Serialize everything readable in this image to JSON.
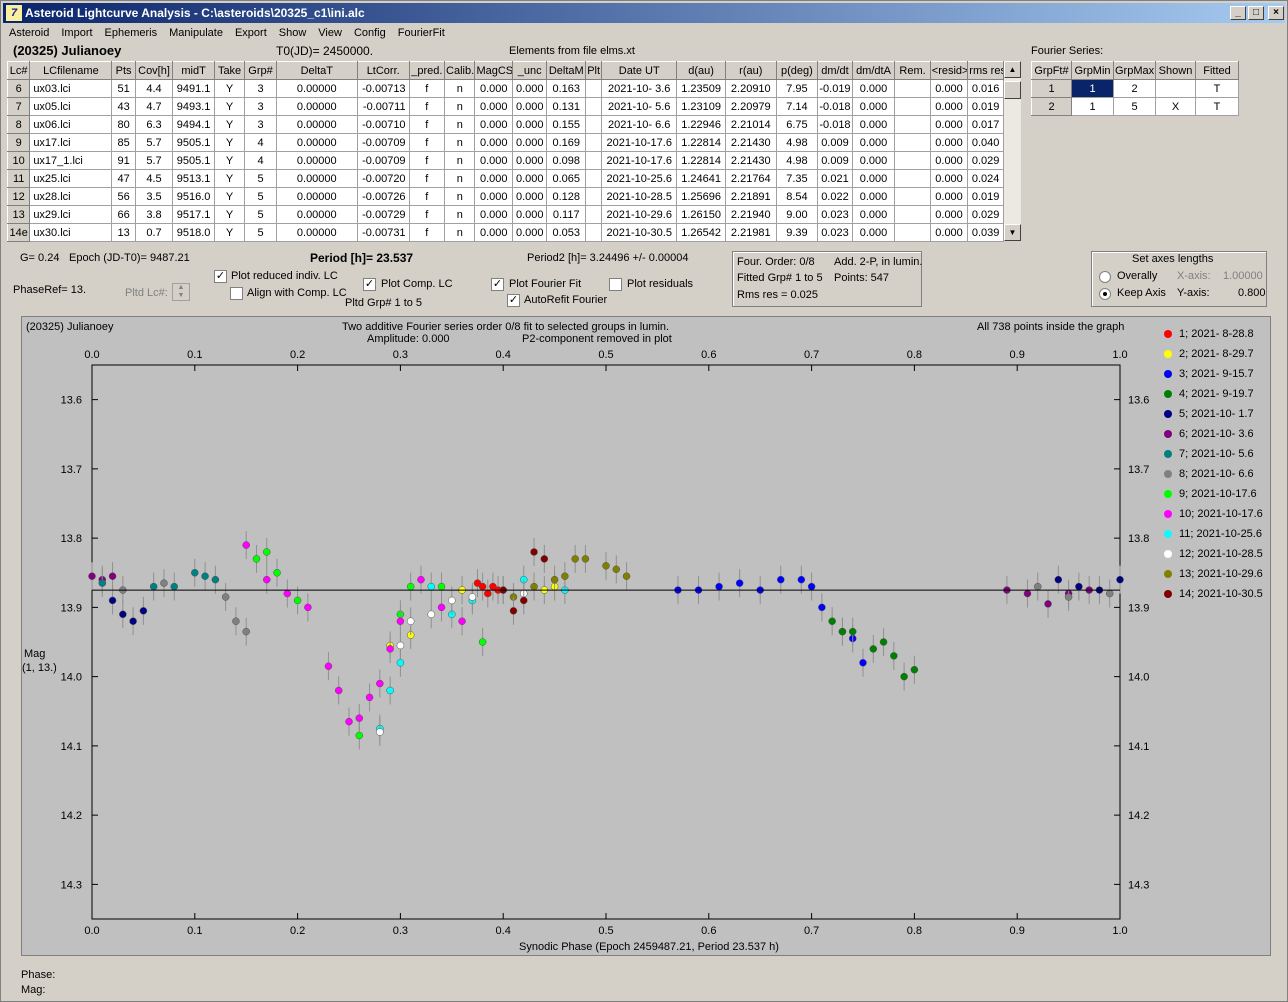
{
  "window": {
    "title": "Asteroid Lightcurve Analysis - C:\\asteroids\\20325_c1\\ini.alc",
    "icon": "app-logo-icon"
  },
  "menu": [
    "Asteroid",
    "Import",
    "Ephemeris",
    "Manipulate",
    "Export",
    "Show",
    "View",
    "Config",
    "FourierFit"
  ],
  "header": {
    "asteroid": "(20325) Julianoey",
    "t0": "T0(JD)= 2450000.",
    "elements": "Elements from file elms.xt",
    "fourier_series": "Fourier Series:"
  },
  "lc_table": {
    "columns": [
      "Lc#",
      "LCfilename",
      "Pts",
      "Cov[h]",
      "midT",
      "Take",
      "Grp#",
      "DeltaT",
      "LtCorr.",
      "_pred.",
      "Calib.",
      "MagCS",
      "_unc",
      "DeltaM",
      "Plt",
      "Date UT",
      "d(au)",
      "r(au)",
      "p(deg)",
      "dm/dt",
      "dm/dtA",
      "Rem.",
      "<resid>",
      "rms res"
    ],
    "rows": [
      [
        "6",
        "ux03.lci",
        "51",
        "4.4",
        "9491.1",
        "Y",
        "3",
        "0.00000",
        "-0.00713",
        "f",
        "n",
        "0.000",
        "0.000",
        "0.163",
        "",
        "2021-10- 3.6",
        "1.23509",
        "2.20910",
        "7.95",
        "-0.019",
        "0.000",
        "",
        "0.000",
        "0.016"
      ],
      [
        "7",
        "ux05.lci",
        "43",
        "4.7",
        "9493.1",
        "Y",
        "3",
        "0.00000",
        "-0.00711",
        "f",
        "n",
        "0.000",
        "0.000",
        "0.131",
        "",
        "2021-10- 5.6",
        "1.23109",
        "2.20979",
        "7.14",
        "-0.018",
        "0.000",
        "",
        "0.000",
        "0.019"
      ],
      [
        "8",
        "ux06.lci",
        "80",
        "6.3",
        "9494.1",
        "Y",
        "3",
        "0.00000",
        "-0.00710",
        "f",
        "n",
        "0.000",
        "0.000",
        "0.155",
        "",
        "2021-10- 6.6",
        "1.22946",
        "2.21014",
        "6.75",
        "-0.018",
        "0.000",
        "",
        "0.000",
        "0.017"
      ],
      [
        "9",
        "ux17.lci",
        "85",
        "5.7",
        "9505.1",
        "Y",
        "4",
        "0.00000",
        "-0.00709",
        "f",
        "n",
        "0.000",
        "0.000",
        "0.169",
        "",
        "2021-10-17.6",
        "1.22814",
        "2.21430",
        "4.98",
        "0.009",
        "0.000",
        "",
        "0.000",
        "0.040"
      ],
      [
        "10",
        "ux17_1.lci",
        "91",
        "5.7",
        "9505.1",
        "Y",
        "4",
        "0.00000",
        "-0.00709",
        "f",
        "n",
        "0.000",
        "0.000",
        "0.098",
        "",
        "2021-10-17.6",
        "1.22814",
        "2.21430",
        "4.98",
        "0.009",
        "0.000",
        "",
        "0.000",
        "0.029"
      ],
      [
        "11",
        "ux25.lci",
        "47",
        "4.5",
        "9513.1",
        "Y",
        "5",
        "0.00000",
        "-0.00720",
        "f",
        "n",
        "0.000",
        "0.000",
        "0.065",
        "",
        "2021-10-25.6",
        "1.24641",
        "2.21764",
        "7.35",
        "0.021",
        "0.000",
        "",
        "0.000",
        "0.024"
      ],
      [
        "12",
        "ux28.lci",
        "56",
        "3.5",
        "9516.0",
        "Y",
        "5",
        "0.00000",
        "-0.00726",
        "f",
        "n",
        "0.000",
        "0.000",
        "0.128",
        "",
        "2021-10-28.5",
        "1.25696",
        "2.21891",
        "8.54",
        "0.022",
        "0.000",
        "",
        "0.000",
        "0.019"
      ],
      [
        "13",
        "ux29.lci",
        "66",
        "3.8",
        "9517.1",
        "Y",
        "5",
        "0.00000",
        "-0.00729",
        "f",
        "n",
        "0.000",
        "0.000",
        "0.117",
        "",
        "2021-10-29.6",
        "1.26150",
        "2.21940",
        "9.00",
        "0.023",
        "0.000",
        "",
        "0.000",
        "0.029"
      ],
      [
        "14e",
        "ux30.lci",
        "13",
        "0.7",
        "9518.0",
        "Y",
        "5",
        "0.00000",
        "-0.00731",
        "f",
        "n",
        "0.000",
        "0.000",
        "0.053",
        "",
        "2021-10-30.5",
        "1.26542",
        "2.21981",
        "9.39",
        "0.023",
        "0.000",
        "",
        "0.000",
        "0.039"
      ]
    ]
  },
  "fourier_table": {
    "columns": [
      "GrpFt#",
      "GrpMin",
      "GrpMax",
      "Shown",
      "Fitted"
    ],
    "rows": [
      [
        "1",
        "1",
        "2",
        "",
        "T"
      ],
      [
        "2",
        "1",
        "5",
        "X",
        "T"
      ]
    ]
  },
  "controls": {
    "g": "G= 0.24",
    "epoch": "Epoch (JD-T0)= 9487.21",
    "period": "Period [h]= 23.537",
    "period2": "Period2 [h]= 3.24496 +/- 0.00004",
    "phaseref": "PhaseRef= 13.",
    "pltd_lc": "Pltd Lc#:",
    "plot_reduced": "Plot reduced indiv. LC",
    "align_comp": "Align with Comp. LC",
    "plot_comp": "Plot Comp. LC",
    "pltd_grp": "Pltd Grp#  1   to   5",
    "plot_fourier": "Plot Fourier Fit",
    "autorefit": "AutoRefit Fourier",
    "plot_residuals": "Plot residuals",
    "four_order": "Four. Order:  0/8",
    "add2p": "Add. 2-P, in lumin.",
    "fitted_grp": "Fitted Grp# 1 to 5",
    "points": "Points: 547",
    "rms": "Rms res     = 0.025",
    "axes_title": "Set axes lengths",
    "overally": "Overally",
    "keep_axis": "Keep Axis",
    "xaxis_lbl": "X-axis:",
    "xaxis_val": "1.00000",
    "yaxis_lbl": "Y-axis:",
    "yaxis_val": "0.800"
  },
  "plot": {
    "name": "(20325) Julianoey",
    "title1": "Two additive Fourier series order 0/8 fit to selected groups in lumin.",
    "title2": "Amplitude: 0.000",
    "p2note": "P2-component removed in plot",
    "allpts": "All 738 points inside the graph",
    "ylabel1": "Mag",
    "ylabel2": "(1, 13.)",
    "xlabel": "Synodic Phase (Epoch 2459487.21, Period 23.537 h)"
  },
  "chart_data": {
    "type": "scatter",
    "xlabel": "Synodic Phase (Epoch 2459487.21, Period 23.537 h)",
    "ylabel": "Mag",
    "xlim": [
      0.0,
      1.0
    ],
    "ylim": [
      14.35,
      13.55
    ],
    "yreversed": true,
    "xticks": [
      "0.0",
      "0.1",
      "0.2",
      "0.3",
      "0.4",
      "0.5",
      "0.6",
      "0.7",
      "0.8",
      "0.9",
      "1.0"
    ],
    "yticks": [
      "13.6",
      "13.7",
      "13.8",
      "13.9",
      "14.0",
      "14.1",
      "14.2",
      "14.3"
    ],
    "fit_line_mag": 13.875,
    "series": [
      {
        "name": "1; 2021- 8-28.8",
        "color": "#ff0000",
        "points": [
          [
            0.375,
            13.865
          ],
          [
            0.38,
            13.87
          ],
          [
            0.385,
            13.88
          ],
          [
            0.39,
            13.87
          ],
          [
            0.395,
            13.875
          ]
        ]
      },
      {
        "name": "2; 2021- 8-29.7",
        "color": "#ffff00",
        "points": [
          [
            0.29,
            13.955
          ],
          [
            0.31,
            13.94
          ],
          [
            0.36,
            13.875
          ],
          [
            0.44,
            13.875
          ],
          [
            0.45,
            13.87
          ]
        ]
      },
      {
        "name": "3; 2021- 9-15.7",
        "color": "#0000ff",
        "points": [
          [
            0.57,
            13.875
          ],
          [
            0.59,
            13.875
          ],
          [
            0.61,
            13.87
          ],
          [
            0.63,
            13.865
          ],
          [
            0.65,
            13.875
          ],
          [
            0.67,
            13.86
          ],
          [
            0.69,
            13.86
          ],
          [
            0.7,
            13.87
          ],
          [
            0.71,
            13.9
          ],
          [
            0.73,
            13.935
          ],
          [
            0.74,
            13.945
          ],
          [
            0.75,
            13.98
          ]
        ]
      },
      {
        "name": "4; 2021- 9-19.7",
        "color": "#008000",
        "points": [
          [
            0.72,
            13.92
          ],
          [
            0.73,
            13.935
          ],
          [
            0.74,
            13.935
          ],
          [
            0.76,
            13.96
          ],
          [
            0.77,
            13.95
          ],
          [
            0.78,
            13.97
          ],
          [
            0.79,
            14.0
          ],
          [
            0.8,
            13.99
          ]
        ]
      },
      {
        "name": "5; 2021-10- 1.7",
        "color": "#000080",
        "points": [
          [
            0.02,
            13.89
          ],
          [
            0.03,
            13.91
          ],
          [
            0.04,
            13.92
          ],
          [
            0.05,
            13.905
          ],
          [
            0.94,
            13.86
          ],
          [
            0.96,
            13.87
          ],
          [
            0.98,
            13.875
          ],
          [
            1.0,
            13.86
          ]
        ]
      },
      {
        "name": "6; 2021-10- 3.6",
        "color": "#800080",
        "points": [
          [
            0.0,
            13.855
          ],
          [
            0.01,
            13.86
          ],
          [
            0.02,
            13.855
          ],
          [
            0.89,
            13.875
          ],
          [
            0.91,
            13.88
          ],
          [
            0.93,
            13.895
          ],
          [
            0.95,
            13.88
          ],
          [
            0.97,
            13.875
          ]
        ]
      },
      {
        "name": "7; 2021-10- 5.6",
        "color": "#008080",
        "points": [
          [
            0.01,
            13.865
          ],
          [
            0.06,
            13.87
          ],
          [
            0.08,
            13.87
          ],
          [
            0.1,
            13.85
          ],
          [
            0.11,
            13.855
          ],
          [
            0.12,
            13.86
          ]
        ]
      },
      {
        "name": "8; 2021-10- 6.6",
        "color": "#808080",
        "points": [
          [
            0.03,
            13.875
          ],
          [
            0.07,
            13.865
          ],
          [
            0.13,
            13.885
          ],
          [
            0.14,
            13.92
          ],
          [
            0.15,
            13.935
          ],
          [
            0.92,
            13.87
          ],
          [
            0.95,
            13.885
          ],
          [
            0.99,
            13.88
          ]
        ]
      },
      {
        "name": "9; 2021-10-17.6",
        "color": "#00ff00",
        "points": [
          [
            0.16,
            13.83
          ],
          [
            0.17,
            13.82
          ],
          [
            0.18,
            13.85
          ],
          [
            0.2,
            13.89
          ],
          [
            0.26,
            14.085
          ],
          [
            0.3,
            13.91
          ],
          [
            0.31,
            13.87
          ],
          [
            0.34,
            13.87
          ],
          [
            0.38,
            13.95
          ]
        ]
      },
      {
        "name": "10; 2021-10-17.6",
        "color": "#ff00ff",
        "points": [
          [
            0.15,
            13.81
          ],
          [
            0.17,
            13.86
          ],
          [
            0.19,
            13.88
          ],
          [
            0.21,
            13.9
          ],
          [
            0.23,
            13.985
          ],
          [
            0.24,
            14.02
          ],
          [
            0.25,
            14.065
          ],
          [
            0.26,
            14.06
          ],
          [
            0.27,
            14.03
          ],
          [
            0.28,
            14.01
          ],
          [
            0.29,
            13.96
          ],
          [
            0.3,
            13.92
          ],
          [
            0.32,
            13.86
          ],
          [
            0.34,
            13.9
          ],
          [
            0.36,
            13.92
          ]
        ]
      },
      {
        "name": "11; 2021-10-25.6",
        "color": "#00ffff",
        "points": [
          [
            0.28,
            14.075
          ],
          [
            0.29,
            14.02
          ],
          [
            0.3,
            13.98
          ],
          [
            0.33,
            13.87
          ],
          [
            0.35,
            13.91
          ],
          [
            0.37,
            13.89
          ],
          [
            0.42,
            13.86
          ],
          [
            0.46,
            13.875
          ]
        ]
      },
      {
        "name": "12; 2021-10-28.5",
        "color": "#ffffff",
        "points": [
          [
            0.28,
            14.08
          ],
          [
            0.3,
            13.955
          ],
          [
            0.31,
            13.92
          ],
          [
            0.33,
            13.91
          ],
          [
            0.35,
            13.89
          ],
          [
            0.37,
            13.885
          ],
          [
            0.4,
            13.875
          ],
          [
            0.42,
            13.88
          ]
        ]
      },
      {
        "name": "13; 2021-10-29.6",
        "color": "#808000",
        "points": [
          [
            0.41,
            13.885
          ],
          [
            0.43,
            13.87
          ],
          [
            0.45,
            13.86
          ],
          [
            0.46,
            13.855
          ],
          [
            0.47,
            13.83
          ],
          [
            0.48,
            13.83
          ],
          [
            0.5,
            13.84
          ],
          [
            0.51,
            13.845
          ],
          [
            0.52,
            13.855
          ]
        ]
      },
      {
        "name": "14; 2021-10-30.5",
        "color": "#800000",
        "points": [
          [
            0.41,
            13.905
          ],
          [
            0.42,
            13.89
          ],
          [
            0.43,
            13.82
          ],
          [
            0.44,
            13.83
          ],
          [
            0.4,
            13.875
          ]
        ]
      }
    ]
  },
  "status": {
    "phase": "Phase:",
    "mag": "Mag:"
  }
}
